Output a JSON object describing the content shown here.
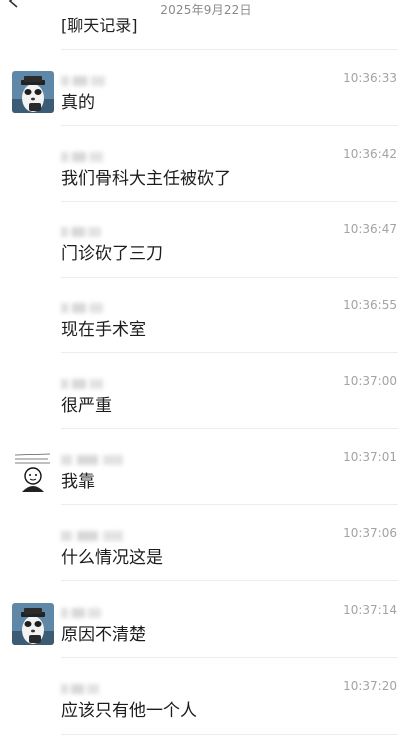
{
  "header": {
    "date": "2025年9月22日",
    "prev_message": "[聊天记录]"
  },
  "messages": [
    {
      "time": "10:36:33",
      "text": "真的",
      "avatar": "panda-avatar",
      "sender_blurred": true
    },
    {
      "time": "10:36:42",
      "text": "我们骨科大主任被砍了",
      "avatar": null,
      "sender_blurred": true
    },
    {
      "time": "10:36:47",
      "text": "门诊砍了三刀",
      "avatar": null,
      "sender_blurred": true
    },
    {
      "time": "10:36:55",
      "text": "现在手术室",
      "avatar": null,
      "sender_blurred": true
    },
    {
      "time": "10:37:00",
      "text": "很严重",
      "avatar": null,
      "sender_blurred": true
    },
    {
      "time": "10:37:01",
      "text": "我靠",
      "avatar": "meme-avatar",
      "sender_blurred": true
    },
    {
      "time": "10:37:06",
      "text": "什么情况这是",
      "avatar": null,
      "sender_blurred": true
    },
    {
      "time": "10:37:14",
      "text": "原因不清楚",
      "avatar": "panda-avatar",
      "sender_blurred": true
    },
    {
      "time": "10:37:20",
      "text": "应该只有他一个人",
      "avatar": null,
      "sender_blurred": true
    }
  ]
}
